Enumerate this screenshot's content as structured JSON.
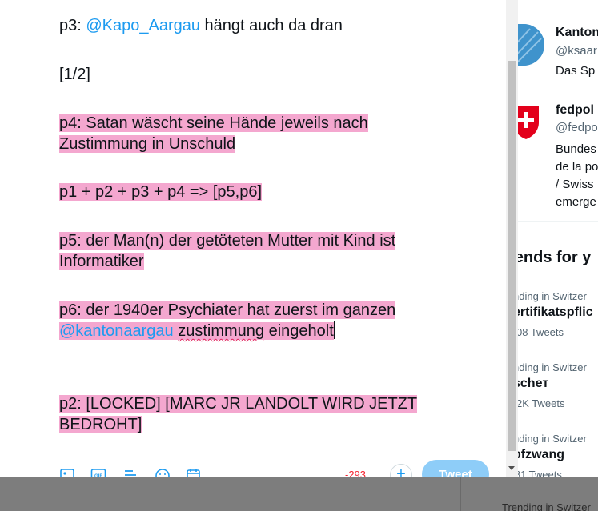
{
  "composer": {
    "lines": {
      "p3_prefix": "p3: ",
      "p3_mention": "@Kapo_Aargau",
      "p3_suffix": " hängt auch da dran",
      "counter": "[1/2]",
      "p4_line1": "p4: Satan wäscht seine Hände jeweils nach ",
      "p4_line2": "Zustimmung in Unschuld",
      "formula": "p1 + p2 + p3 + p4 => [p5,p6]",
      "p5_line1": "p5: der Man(n) der getöteten Mutter mit Kind ist ",
      "p5_line2": "Informatiker",
      "p6_line1": "p6: der 1940er Psychiater hat zuerst im ganzen",
      "p6_mention": "@kantonaargau",
      "p6_word": "zustimmung",
      "p6_rest": " eingeholt",
      "p2_line1": "p2: [LOCKED] [MARC JR LANDOLT WIRD JETZT ",
      "p2_line2": "BEDROHT]"
    },
    "char_count": "-293",
    "add_label": "+",
    "tweet_label": "Tweet"
  },
  "sidebar": {
    "accounts": [
      {
        "name": "Kanton",
        "handle": "@ksaar",
        "bio": [
          "Das Sp"
        ]
      },
      {
        "name": "fedpol",
        "handle": "@fedpo",
        "bio": [
          "Bundes",
          "de la po",
          "/ Swiss",
          "emerge"
        ]
      }
    ],
    "trends_title": "rends for y",
    "trends": [
      {
        "context": "nding in Switzer",
        "name": "ertifikatspflic",
        "count": "08 Tweets"
      },
      {
        "context": "nding in Switzer",
        "name": "scheт",
        "count": "2K Tweets"
      },
      {
        "context": "nding in Switzer",
        "name": "pfzwang",
        "count": ",181 Tweets"
      }
    ],
    "ghost_trend": "Trending in Switzer"
  },
  "colors": {
    "highlight": "#f4a7cf",
    "mention": "#1d9bf0",
    "tweet_button": "#8ecdf8",
    "counter": "#f4212e"
  }
}
